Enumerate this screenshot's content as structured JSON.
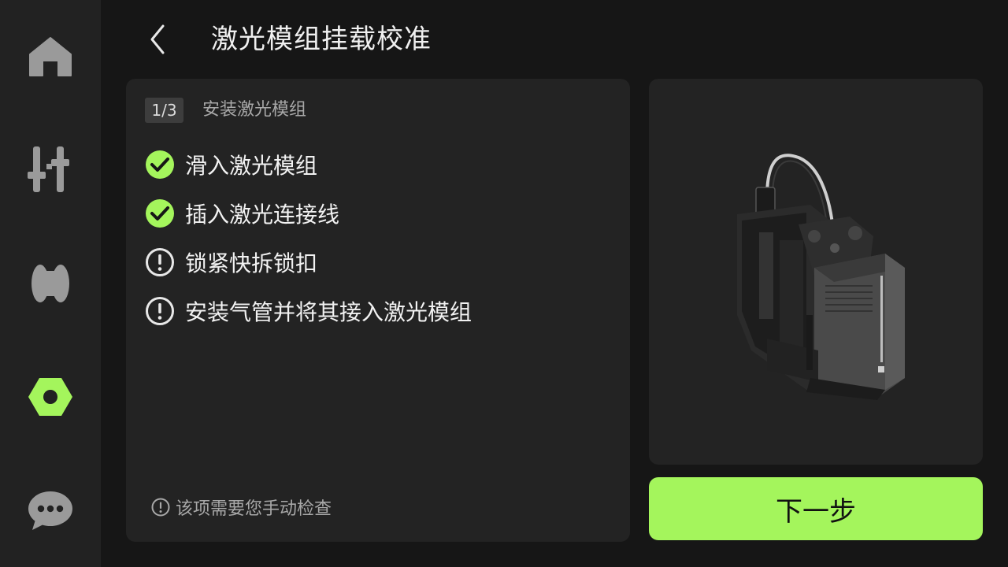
{
  "header": {
    "title": "激光模组挂载校准"
  },
  "sidebar": {
    "items": [
      {
        "icon": "home-icon",
        "active": false
      },
      {
        "icon": "sliders-icon",
        "active": false
      },
      {
        "icon": "filament-spool-icon",
        "active": false
      },
      {
        "icon": "hex-nut-settings-icon",
        "active": true
      },
      {
        "icon": "chat-bubble-icon",
        "active": false
      }
    ]
  },
  "step": {
    "counter": "1/3",
    "heading": "安装激光模组",
    "items": [
      {
        "label": "滑入激光模组",
        "status": "done"
      },
      {
        "label": "插入激光连接线",
        "status": "done"
      },
      {
        "label": "锁紧快拆锁扣",
        "status": "manual"
      },
      {
        "label": "安装气管并将其接入激光模组",
        "status": "manual"
      }
    ],
    "manual_note": "该项需要您手动检查"
  },
  "actions": {
    "next_label": "下一步"
  },
  "colors": {
    "accent": "#a4f55c",
    "background": "#161616",
    "panel": "#232323",
    "sidebar": "#222222"
  }
}
